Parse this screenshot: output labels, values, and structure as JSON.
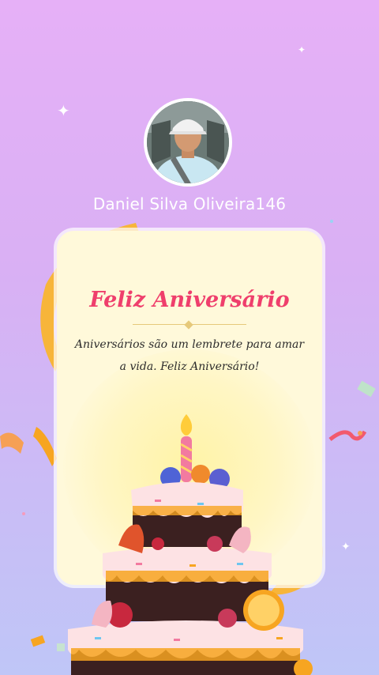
{
  "profile": {
    "name": "Daniel Silva Oliveira146"
  },
  "card": {
    "title": "Feliz Aniversário",
    "message": "Aniversários são um lembrete para amar a vida. Feliz Aniversário!"
  },
  "colors": {
    "background_top": "#e6b0f7",
    "background_bottom": "#bfc6f7",
    "card_background": "#fff9da",
    "title_pink": "#ef3f6c",
    "ribbon_orange": "#f7a521"
  },
  "icons": {
    "sparkle": "four-point-star",
    "cake": "birthday-cake-icon"
  }
}
